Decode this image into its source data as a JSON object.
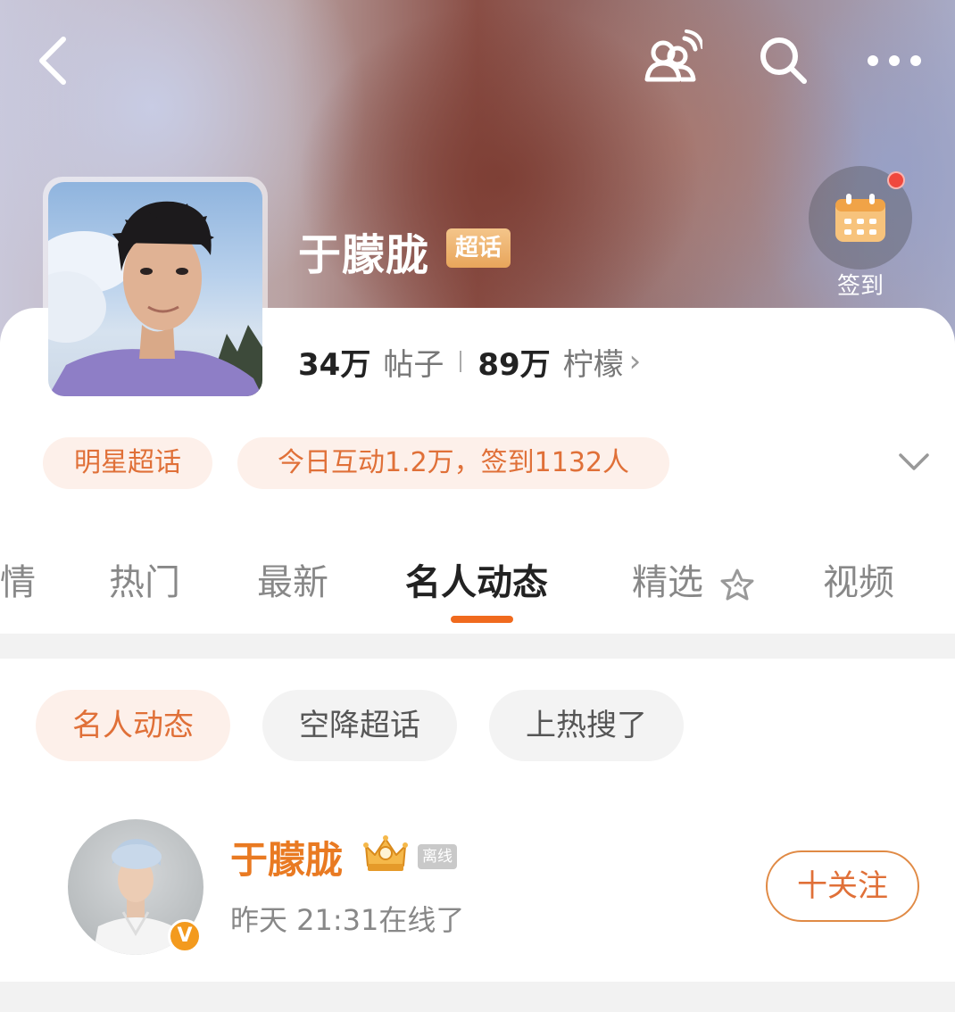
{
  "header": {
    "topic_name": "于朦胧",
    "topic_badge": "超话",
    "checkin_label": "签到",
    "icons": [
      "back-icon",
      "message-people-icon",
      "search-icon",
      "more-icon",
      "calendar-icon"
    ]
  },
  "stats": {
    "posts_count": "34万",
    "posts_label": "帖子",
    "lemons_count": "89万",
    "lemons_label": "柠檬",
    "chevron": "›"
  },
  "pills": {
    "category": "明星超话",
    "today": "今日互动1.2万，签到1132人"
  },
  "tabs": [
    {
      "label": "情"
    },
    {
      "label": "热门"
    },
    {
      "label": "最新"
    },
    {
      "label": "名人动态"
    },
    {
      "label": "精选"
    },
    {
      "label": "视频"
    }
  ],
  "active_tab": "名人动态",
  "subtabs": [
    {
      "label": "名人动态"
    },
    {
      "label": "空降超话"
    },
    {
      "label": "上热搜了"
    }
  ],
  "user": {
    "name": "于朦胧",
    "offline_tag": "离线",
    "status": "昨天 21:31在线了",
    "verified_mark": "V",
    "follow_label": "十关注"
  },
  "colors": {
    "accent": "#f06a1e",
    "pill_bg": "#fdf0ea",
    "pill_text": "#e07038",
    "name_color": "#e97a22",
    "badge": "#e8a55b"
  }
}
